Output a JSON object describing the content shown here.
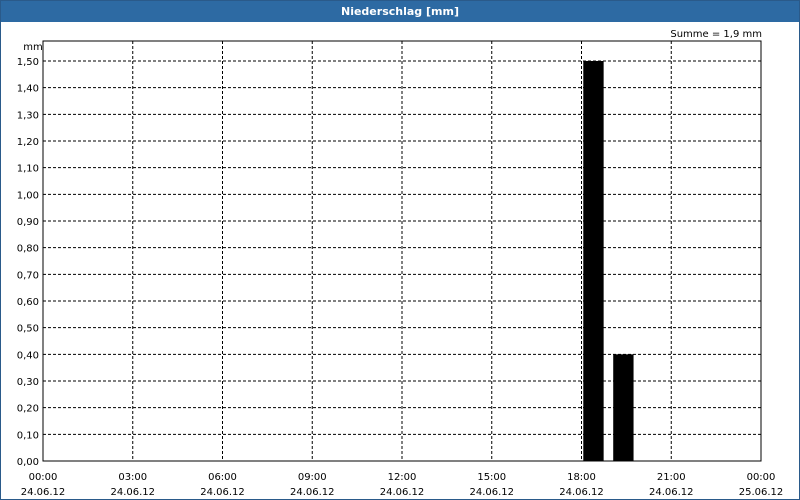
{
  "window": {
    "title": "Niederschlag [mm]"
  },
  "summary": "Summe = 1,9 mm",
  "colors": {
    "title_bar": "#2d6aa3",
    "bars": "#000000",
    "grid": "#000000"
  },
  "chart_data": {
    "type": "bar",
    "title": "Niederschlag [mm]",
    "ylabel": "mm",
    "xlabel": "",
    "ylim": [
      0,
      1.5
    ],
    "y_ticks": [
      "0,00",
      "0,10",
      "0,20",
      "0,30",
      "0,40",
      "0,50",
      "0,60",
      "0,70",
      "0,80",
      "0,90",
      "1,00",
      "1,10",
      "1,20",
      "1,30",
      "1,40",
      "1,50"
    ],
    "x_range_hours": [
      0,
      24
    ],
    "x_ticks": [
      {
        "time": "00:00",
        "date": "24.06.12"
      },
      {
        "time": "03:00",
        "date": "24.06.12"
      },
      {
        "time": "06:00",
        "date": "24.06.12"
      },
      {
        "time": "09:00",
        "date": "24.06.12"
      },
      {
        "time": "12:00",
        "date": "24.06.12"
      },
      {
        "time": "15:00",
        "date": "24.06.12"
      },
      {
        "time": "18:00",
        "date": "24.06.12"
      },
      {
        "time": "21:00",
        "date": "24.06.12"
      },
      {
        "time": "00:00",
        "date": "25.06.12"
      }
    ],
    "bars": [
      {
        "time": "18:00",
        "value": 1.5
      },
      {
        "time": "19:00",
        "value": 0.4
      }
    ],
    "grid": true,
    "total": 1.9
  }
}
